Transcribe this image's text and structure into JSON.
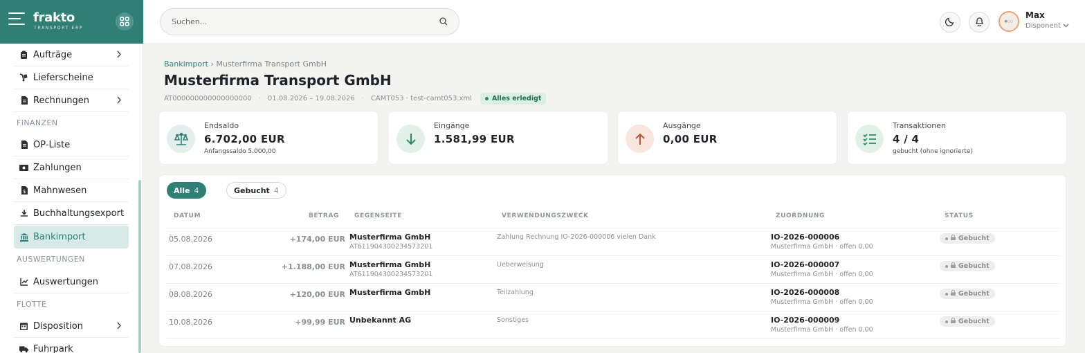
{
  "brand": {
    "name": "frakto",
    "tagline": "TRANSPORT ERP"
  },
  "sidebar": {
    "items": [
      {
        "label": "Aufträge",
        "has_children": true
      },
      {
        "label": "Lieferscheine",
        "has_children": false
      },
      {
        "label": "Rechnungen",
        "has_children": true
      },
      {
        "section": "FINANZEN"
      },
      {
        "label": "OP-Liste",
        "has_children": false
      },
      {
        "label": "Zahlungen",
        "has_children": false
      },
      {
        "label": "Mahnwesen",
        "has_children": false
      },
      {
        "label": "Buchhaltungsexport",
        "has_children": false
      },
      {
        "label": "Bankimport",
        "has_children": false,
        "active": true
      },
      {
        "section": "AUSWERTUNGEN"
      },
      {
        "label": "Auswertungen",
        "has_children": false
      },
      {
        "section": "FLOTTE"
      },
      {
        "label": "Disposition",
        "has_children": true
      },
      {
        "label": "Fuhrpark",
        "has_children": false
      }
    ]
  },
  "header": {
    "search_placeholder": "Suchen...",
    "user": {
      "name": "Max",
      "role": "Disponent"
    }
  },
  "breadcrumb": {
    "root": "Bankimport",
    "separator": "›",
    "current": "Musterfirma Transport GmbH"
  },
  "page": {
    "title": "Musterfirma Transport GmbH",
    "iban": "AT000000000000000000",
    "period": "01.08.2026 – 19.08.2026",
    "source": "CAMT053 · test-camt053.xml",
    "status": "Alles erledigt"
  },
  "cards": [
    {
      "label": "Endsaldo",
      "value": "6.702,00 EUR",
      "sub": "Anfangssaldo 5.000,00",
      "icon": "balance-scale-icon"
    },
    {
      "label": "Eingänge",
      "value": "1.581,99 EUR",
      "sub": "",
      "icon": "arrow-down-icon"
    },
    {
      "label": "Ausgänge",
      "value": "0,00 EUR",
      "sub": "",
      "icon": "arrow-up-icon"
    },
    {
      "label": "Transaktionen",
      "value": "4 / 4",
      "sub": "gebucht (ohne ignorierte)",
      "icon": "checklist-icon"
    }
  ],
  "filters": [
    {
      "label": "Alle",
      "count": "4"
    },
    {
      "label": "Gebucht",
      "count": "4"
    }
  ],
  "table": {
    "columns": [
      "DATUM",
      "BETRAG",
      "GEGENSEITE",
      "VERWENDUNGSZWECK",
      "ZUORDNUNG",
      "STATUS"
    ],
    "rows": [
      {
        "date": "05.08.2026",
        "amount": "+174,00 EUR",
        "party": "Musterfirma GmbH",
        "iban": "AT611904300234573201",
        "purpose": "Zahlung Rechnung IO-2026-000006 vielen Dank",
        "ref": "IO-2026-000006",
        "ref_sub": "Musterfirma GmbH · offen 0,00",
        "status": "Gebucht"
      },
      {
        "date": "07.08.2026",
        "amount": "+1.188,00 EUR",
        "party": "Musterfirma GmbH",
        "iban": "AT611904300234573201",
        "purpose": "Ueberweisung",
        "ref": "IO-2026-000007",
        "ref_sub": "Musterfirma GmbH · offen 0,00",
        "status": "Gebucht"
      },
      {
        "date": "08.08.2026",
        "amount": "+120,00 EUR",
        "party": "Musterfirma GmbH",
        "iban": "",
        "purpose": "Teilzahlung",
        "ref": "IO-2026-000008",
        "ref_sub": "Musterfirma GmbH · offen 0,00",
        "status": "Gebucht"
      },
      {
        "date": "10.08.2026",
        "amount": "+99,99 EUR",
        "party": "Unbekannt AG",
        "iban": "",
        "purpose": "Sonstiges",
        "ref": "IO-2026-000009",
        "ref_sub": "Musterfirma GmbH · offen 0,00",
        "status": "Gebucht"
      }
    ]
  },
  "colors": {
    "brand": "#2f7f75",
    "success": "#2e8a5c",
    "danger": "#c4522f"
  }
}
